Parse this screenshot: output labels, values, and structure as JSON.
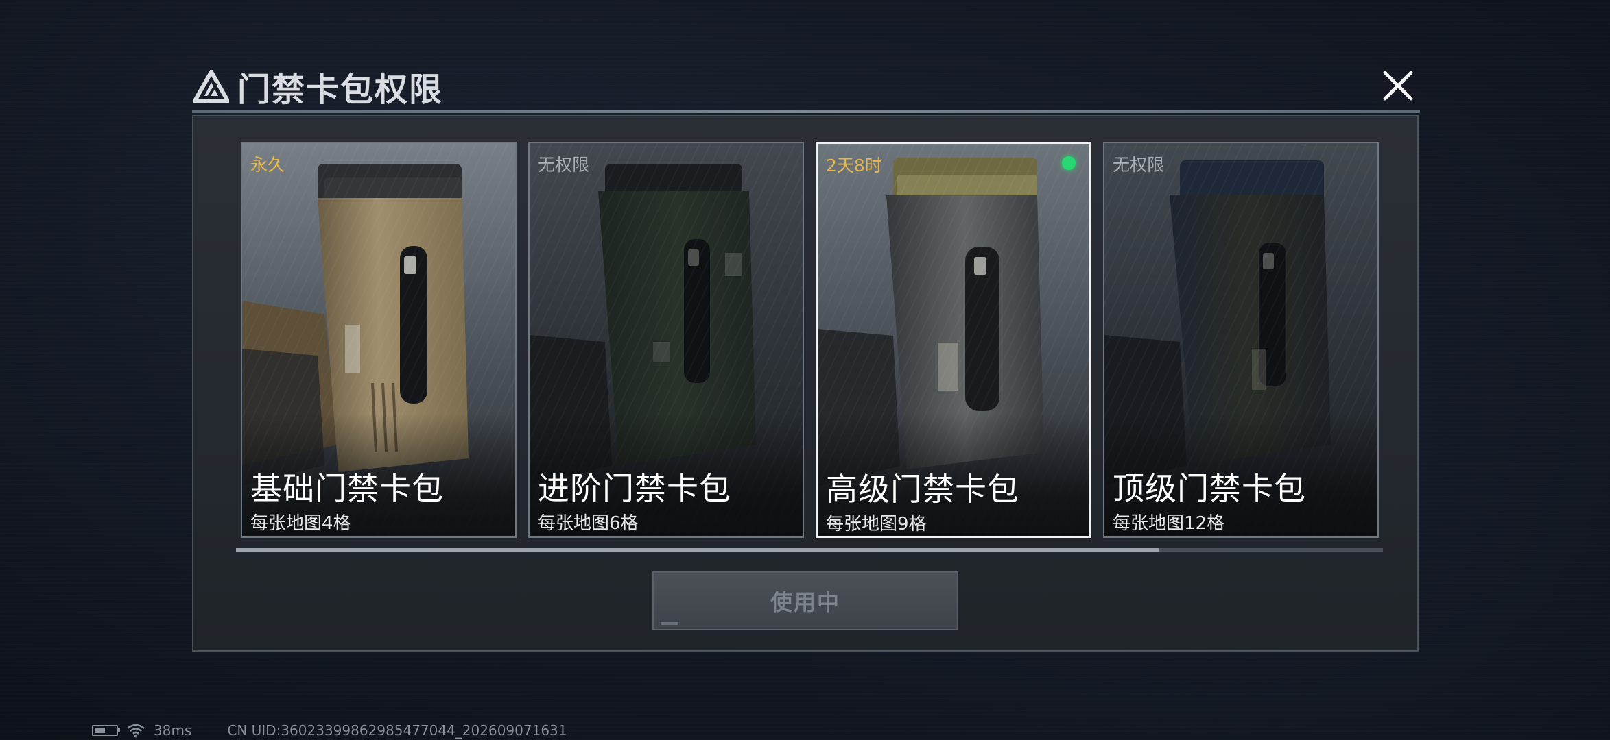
{
  "window": {
    "title": "门禁卡包权限"
  },
  "cards": [
    {
      "tag": "永久",
      "tag_color": "#e8b84a",
      "name": "基础门禁卡包",
      "desc": "每张地图4格",
      "palette": "tan",
      "selected": false
    },
    {
      "tag": "无权限",
      "tag_color": "#a9afb5",
      "name": "进阶门禁卡包",
      "desc": "每张地图6格",
      "palette": "green",
      "selected": false
    },
    {
      "tag": "2天8时",
      "tag_color": "#e8b84a",
      "name": "高级门禁卡包",
      "desc": "每张地图9格",
      "palette": "steel",
      "selected": true
    },
    {
      "tag": "无权限",
      "tag_color": "#a9afb5",
      "name": "顶级门禁卡包",
      "desc": "每张地图12格",
      "palette": "blue",
      "selected": false
    }
  ],
  "action": {
    "use_label": "使用中"
  },
  "status": {
    "ping": "38ms",
    "uid": "CN UID:36023399862985477044_202609071631",
    "battery_level": 0.5
  },
  "icons": {
    "logo": "triangle-logo-icon",
    "close": "close-icon",
    "battery": "battery-icon",
    "wifi": "wifi-icon",
    "active_dot": "active-dot-icon"
  },
  "colors": {
    "active_dot": "#27d873",
    "selected_border": "#f1f3f5",
    "tag_gold": "#e8b84a"
  }
}
